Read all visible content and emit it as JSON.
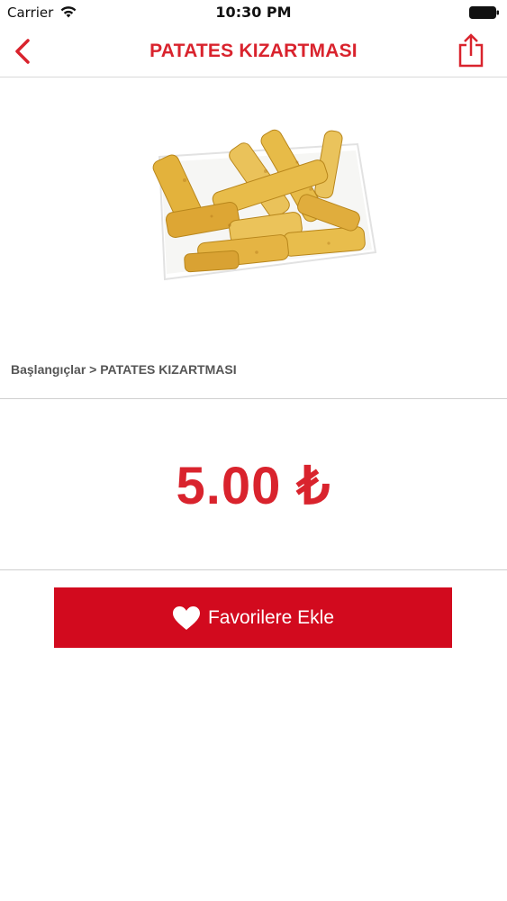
{
  "status_bar": {
    "carrier": "Carrier",
    "time": "10:30 PM"
  },
  "nav": {
    "title": "PATATES KIZARTMASI",
    "back_icon": "chevron-left-icon",
    "share_icon": "share-icon"
  },
  "product": {
    "image_alt": "fries-image",
    "breadcrumb": "Başlangıçlar > PATATES KIZARTMASI",
    "price": "5.00 ₺"
  },
  "actions": {
    "favorite_label": "Favorilere Ekle",
    "favorite_icon": "heart-icon"
  },
  "colors": {
    "accent": "#d9232d",
    "button": "#d20a1e"
  }
}
